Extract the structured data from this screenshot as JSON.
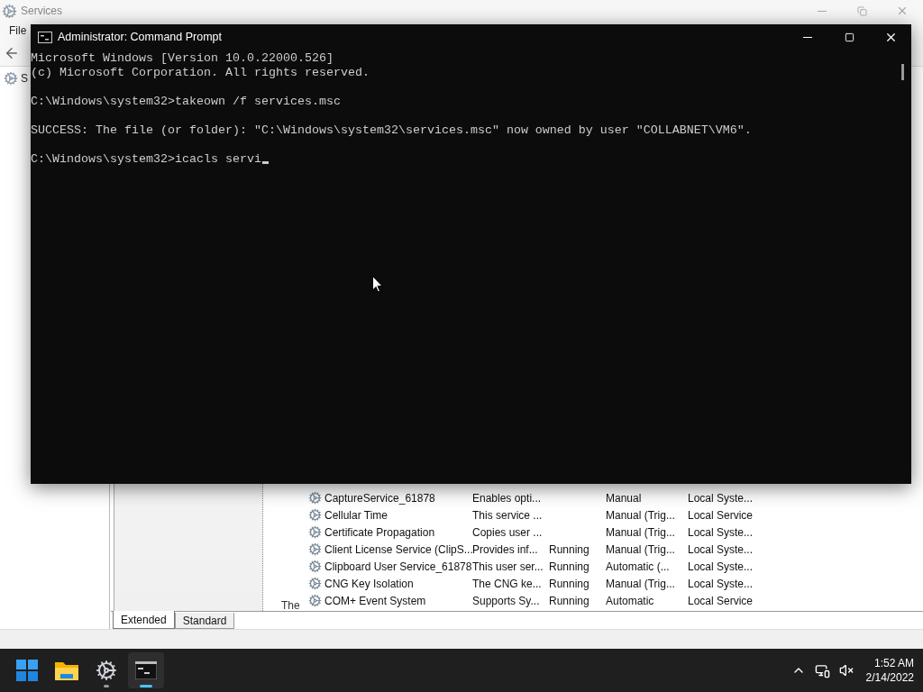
{
  "services_window": {
    "title": "Services",
    "menu": [
      "File"
    ],
    "tree_item": "S",
    "fragment": "The",
    "rows": [
      {
        "name": "CaptureService_61878",
        "description": "Enables opti...",
        "startup_type": "Manual",
        "log_on_as": "Local Syste..."
      },
      {
        "name": "Cellular Time",
        "description": "This service ...",
        "startup_type": "Manual (Trig...",
        "log_on_as": "Local Service"
      },
      {
        "name": "Certificate Propagation",
        "description": "Copies user ...",
        "startup_type": "Manual (Trig...",
        "log_on_as": "Local Syste..."
      },
      {
        "name": "Client License Service (ClipS...",
        "description": "Provides inf...",
        "status": "Running",
        "startup_type": "Manual (Trig...",
        "log_on_as": "Local Syste..."
      },
      {
        "name": "Clipboard User Service_61878",
        "description": "This user ser...",
        "status": "Running",
        "startup_type": "Automatic (...",
        "log_on_as": "Local Syste..."
      },
      {
        "name": "CNG Key Isolation",
        "description": "The CNG ke...",
        "status": "Running",
        "startup_type": "Manual (Trig...",
        "log_on_as": "Local Syste..."
      },
      {
        "name": "COM+ Event System",
        "description": "Supports Sy...",
        "status": "Running",
        "startup_type": "Automatic",
        "log_on_as": "Local Service"
      }
    ],
    "tabs": [
      {
        "label": "Extended",
        "selected": true
      },
      {
        "label": "Standard",
        "selected": false
      }
    ]
  },
  "console": {
    "title": "Administrator: Command Prompt",
    "blocks": [
      [
        "Microsoft Windows [Version 10.0.22000.526]",
        "(c) Microsoft Corporation. All rights reserved."
      ],
      [
        "C:\\Windows\\system32>takeown /f services.msc"
      ],
      [
        "SUCCESS: The file (or folder): \"C:\\Windows\\system32\\services.msc\" now owned by user \"COLLABNET\\VM6\"."
      ]
    ],
    "input": "C:\\Windows\\system32>icacls servi"
  },
  "taskbar": {
    "apps": [
      {
        "kind": "start",
        "running": false,
        "active": false
      },
      {
        "kind": "explorer",
        "running": false,
        "active": false
      },
      {
        "kind": "settings",
        "running": true,
        "active": false
      },
      {
        "kind": "terminal",
        "running": true,
        "active": true
      }
    ],
    "time": "1:52 AM",
    "date": "2/14/2022"
  }
}
